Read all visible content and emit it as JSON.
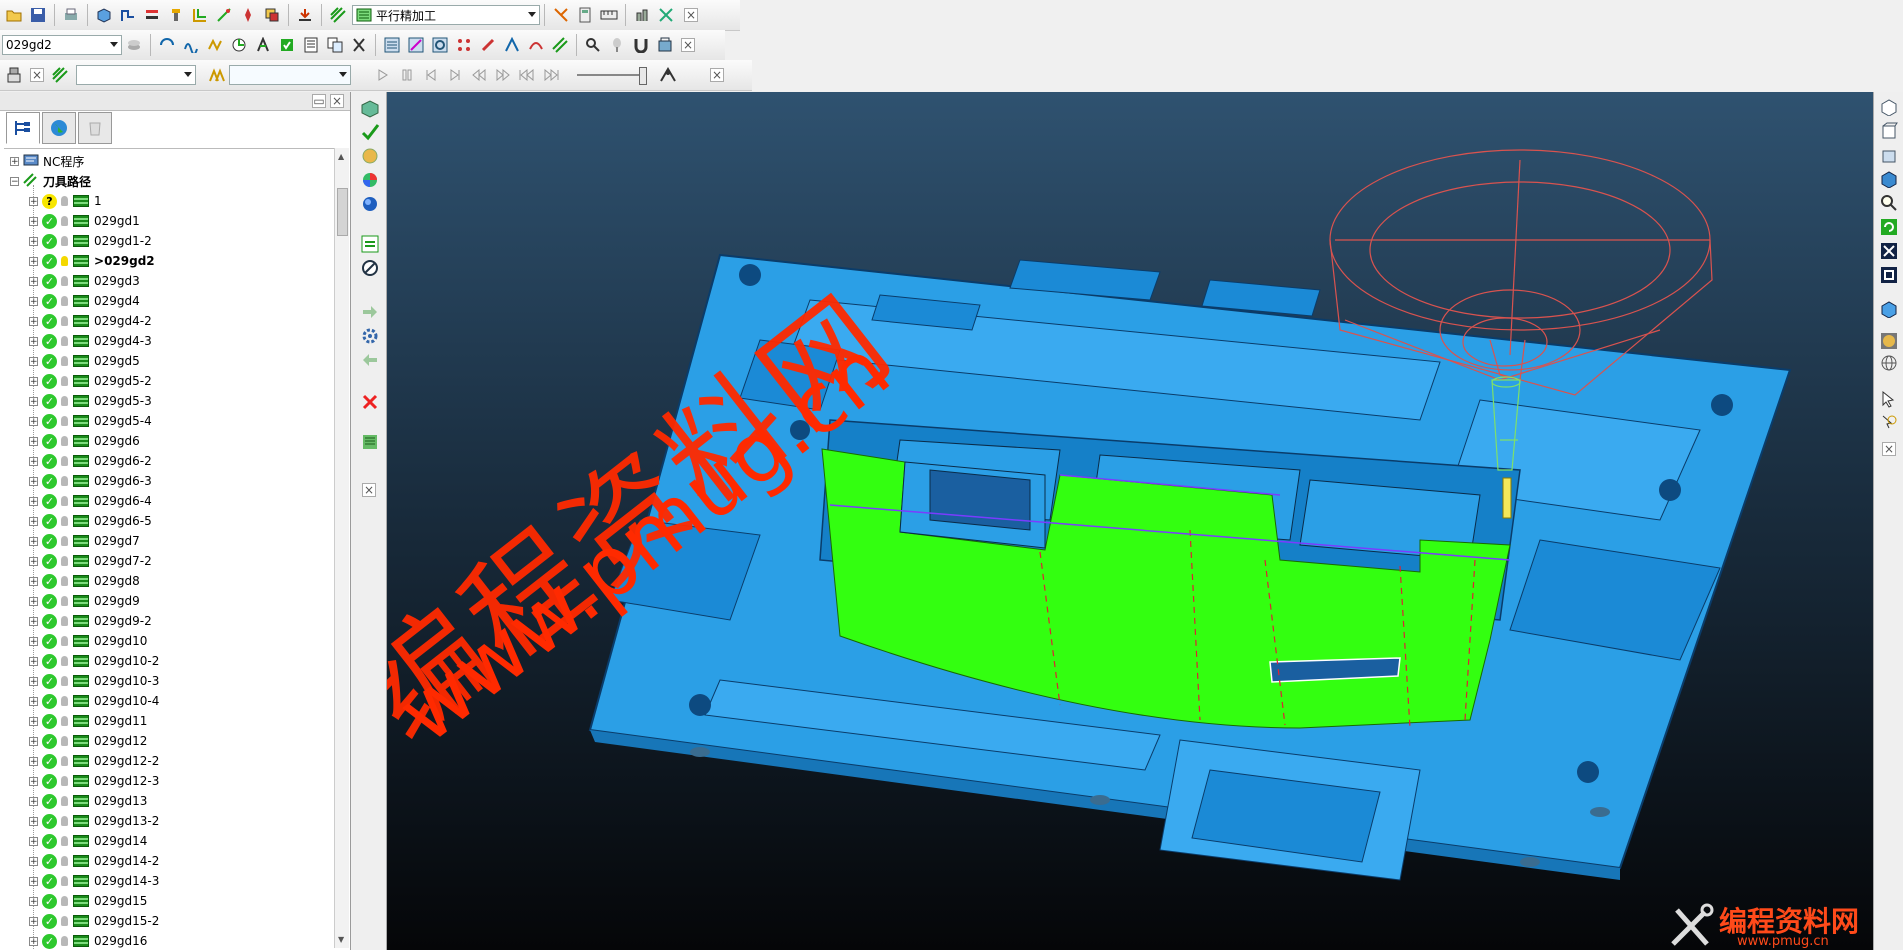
{
  "toolbar1": {
    "operation_combo": "平行精加工"
  },
  "toolbar2": {
    "toolpath_combo": "029gd2"
  },
  "toolbar3": {
    "combo_a": "",
    "combo_b": ""
  },
  "tree": {
    "nc_programs": "NC程序",
    "toolpaths": "刀具路径",
    "items": [
      {
        "label": "1",
        "status": "unknown"
      },
      {
        "label": "029gd1",
        "status": "ok"
      },
      {
        "label": "029gd1-2",
        "status": "ok"
      },
      {
        "label": "029gd2",
        "status": "ok",
        "active": true
      },
      {
        "label": "029gd3",
        "status": "ok"
      },
      {
        "label": "029gd4",
        "status": "ok"
      },
      {
        "label": "029gd4-2",
        "status": "ok"
      },
      {
        "label": "029gd4-3",
        "status": "ok"
      },
      {
        "label": "029gd5",
        "status": "ok"
      },
      {
        "label": "029gd5-2",
        "status": "ok"
      },
      {
        "label": "029gd5-3",
        "status": "ok"
      },
      {
        "label": "029gd5-4",
        "status": "ok"
      },
      {
        "label": "029gd6",
        "status": "ok"
      },
      {
        "label": "029gd6-2",
        "status": "ok"
      },
      {
        "label": "029gd6-3",
        "status": "ok"
      },
      {
        "label": "029gd6-4",
        "status": "ok"
      },
      {
        "label": "029gd6-5",
        "status": "ok"
      },
      {
        "label": "029gd7",
        "status": "ok"
      },
      {
        "label": "029gd7-2",
        "status": "ok"
      },
      {
        "label": "029gd8",
        "status": "ok"
      },
      {
        "label": "029gd9",
        "status": "ok"
      },
      {
        "label": "029gd9-2",
        "status": "ok"
      },
      {
        "label": "029gd10",
        "status": "ok"
      },
      {
        "label": "029gd10-2",
        "status": "ok"
      },
      {
        "label": "029gd10-3",
        "status": "ok"
      },
      {
        "label": "029gd10-4",
        "status": "ok"
      },
      {
        "label": "029gd11",
        "status": "ok"
      },
      {
        "label": "029gd12",
        "status": "ok"
      },
      {
        "label": "029gd12-2",
        "status": "ok"
      },
      {
        "label": "029gd12-3",
        "status": "ok"
      },
      {
        "label": "029gd13",
        "status": "ok"
      },
      {
        "label": "029gd13-2",
        "status": "ok"
      },
      {
        "label": "029gd14",
        "status": "ok"
      },
      {
        "label": "029gd14-2",
        "status": "ok"
      },
      {
        "label": "029gd14-3",
        "status": "ok"
      },
      {
        "label": "029gd15",
        "status": "ok"
      },
      {
        "label": "029gd15-2",
        "status": "ok"
      },
      {
        "label": "029gd16",
        "status": "ok"
      }
    ]
  },
  "watermark": {
    "chinese": "编程资料网",
    "url": "www.pmug.cn",
    "corner_text": "编程资料网",
    "corner_url": "www.pmug.cn"
  },
  "colors": {
    "model_blue": "#2b9fe6",
    "toolpath_green": "#33ff10",
    "watermark_red": "#ff2a00",
    "tool_wire": "#d9534f"
  }
}
